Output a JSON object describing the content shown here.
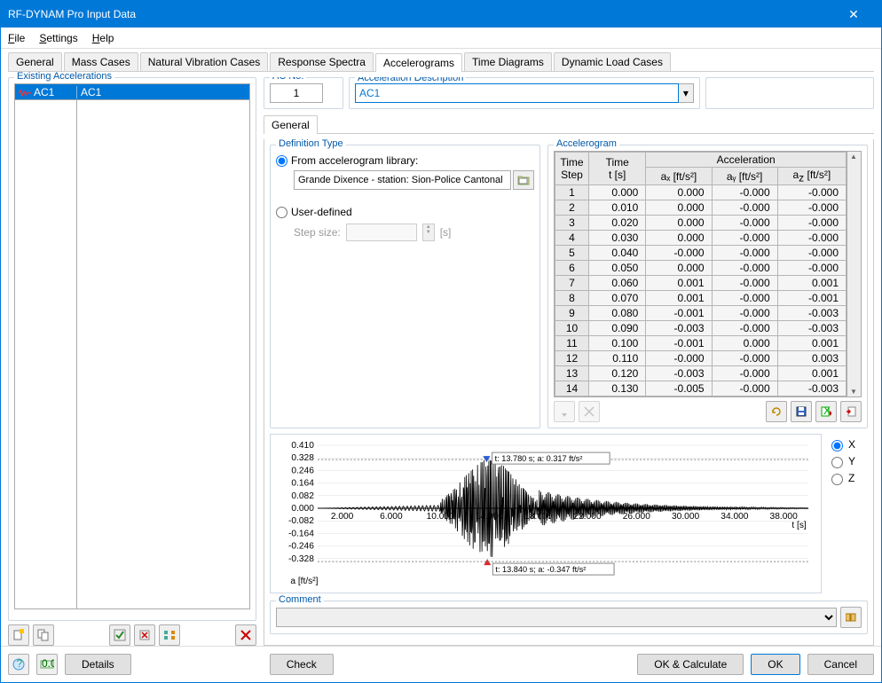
{
  "window": {
    "title": "RF-DYNAM Pro Input Data"
  },
  "menu": {
    "file": "File",
    "settings": "Settings",
    "help": "Help"
  },
  "tabs": {
    "items": [
      {
        "label": "General"
      },
      {
        "label": "Mass Cases"
      },
      {
        "label": "Natural Vibration Cases"
      },
      {
        "label": "Response Spectra"
      },
      {
        "label": "Accelerograms"
      },
      {
        "label": "Time Diagrams"
      },
      {
        "label": "Dynamic Load Cases"
      }
    ],
    "activeIndex": 4
  },
  "leftPanel": {
    "legend": "Existing Accelerations",
    "items": [
      {
        "code": "AC1",
        "name": "AC1"
      }
    ],
    "icons": [
      "new",
      "copy",
      "toggle",
      "delete-col",
      "reorder",
      "delete"
    ]
  },
  "acno": {
    "label": "AC No.",
    "value": "1"
  },
  "acdesc": {
    "label": "Acceleration Description",
    "value": "AC1"
  },
  "innerTab": {
    "label": "General"
  },
  "defType": {
    "legend": "Definition Type",
    "opt1": "From accelerogram library:",
    "library": "Grande Dixence - station: Sion-Police Cantonal",
    "opt2": "User-defined",
    "stepLabel": "Step size:",
    "stepUnit": "[s]"
  },
  "accelerogram": {
    "legend": "Accelerogram",
    "h_step": "Time\nStep",
    "h_time": "Time\nt [s]",
    "h_acc": "Acceleration",
    "h_ax": "aₓ [ft/s²]",
    "h_ay": "aᵧ [ft/s²]",
    "h_az": "a_z [ft/s²]",
    "rows": [
      {
        "n": "1",
        "t": "0.000",
        "ax": "0.000",
        "ay": "-0.000",
        "az": "-0.000"
      },
      {
        "n": "2",
        "t": "0.010",
        "ax": "0.000",
        "ay": "-0.000",
        "az": "-0.000"
      },
      {
        "n": "3",
        "t": "0.020",
        "ax": "0.000",
        "ay": "-0.000",
        "az": "-0.000"
      },
      {
        "n": "4",
        "t": "0.030",
        "ax": "0.000",
        "ay": "-0.000",
        "az": "-0.000"
      },
      {
        "n": "5",
        "t": "0.040",
        "ax": "-0.000",
        "ay": "-0.000",
        "az": "-0.000"
      },
      {
        "n": "6",
        "t": "0.050",
        "ax": "0.000",
        "ay": "-0.000",
        "az": "-0.000"
      },
      {
        "n": "7",
        "t": "0.060",
        "ax": "0.001",
        "ay": "-0.000",
        "az": "0.001"
      },
      {
        "n": "8",
        "t": "0.070",
        "ax": "0.001",
        "ay": "-0.000",
        "az": "-0.001"
      },
      {
        "n": "9",
        "t": "0.080",
        "ax": "-0.001",
        "ay": "-0.000",
        "az": "-0.003"
      },
      {
        "n": "10",
        "t": "0.090",
        "ax": "-0.003",
        "ay": "-0.000",
        "az": "-0.003"
      },
      {
        "n": "11",
        "t": "0.100",
        "ax": "-0.001",
        "ay": "0.000",
        "az": "0.001"
      },
      {
        "n": "12",
        "t": "0.110",
        "ax": "-0.000",
        "ay": "-0.000",
        "az": "0.003"
      },
      {
        "n": "13",
        "t": "0.120",
        "ax": "-0.003",
        "ay": "-0.000",
        "az": "0.001"
      },
      {
        "n": "14",
        "t": "0.130",
        "ax": "-0.005",
        "ay": "-0.000",
        "az": "-0.003"
      }
    ]
  },
  "chart_data": {
    "type": "line",
    "xlabel": "t [s]",
    "ylabel": "a [ft/s²]",
    "xlim": [
      0,
      40
    ],
    "ylim": [
      -0.41,
      0.41
    ],
    "xticks": [
      2.0,
      6.0,
      10.0,
      14.0,
      18.0,
      22.0,
      26.0,
      30.0,
      34.0,
      38.0
    ],
    "yticks": [
      -0.328,
      -0.246,
      -0.164,
      -0.082,
      0.0,
      0.082,
      0.164,
      0.246,
      0.328,
      0.41
    ],
    "peak_max": {
      "t": 13.78,
      "a": 0.317,
      "label": "t: 13.780 s; a: 0.317 ft/s²"
    },
    "peak_min": {
      "t": 13.84,
      "a": -0.347,
      "label": "t: 13.840 s; a: -0.347 ft/s²"
    },
    "series_name": "X"
  },
  "axisRadios": {
    "x": "X",
    "y": "Y",
    "z": "Z"
  },
  "comment": {
    "legend": "Comment",
    "value": ""
  },
  "footer": {
    "details": "Details",
    "check": "Check",
    "okcalc": "OK & Calculate",
    "ok": "OK",
    "cancel": "Cancel"
  }
}
